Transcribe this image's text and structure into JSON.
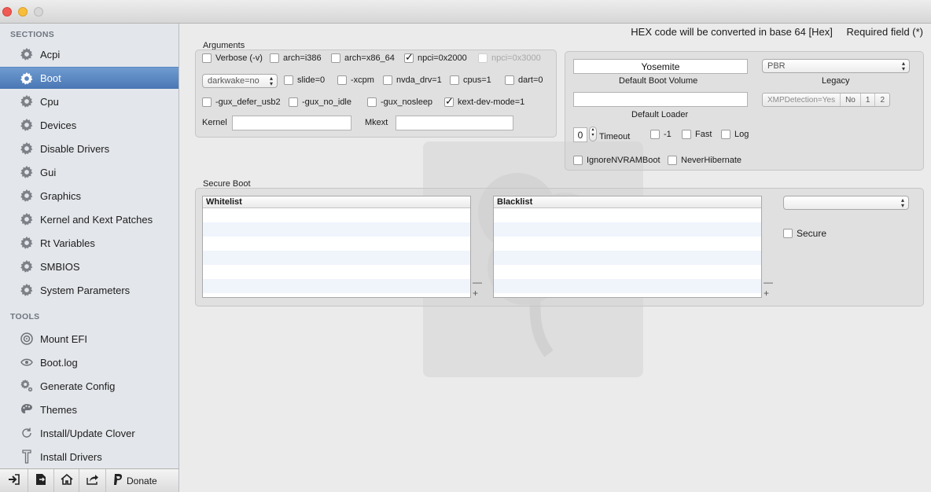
{
  "sidebar": {
    "sections_header": "SECTIONS",
    "tools_header": "TOOLS",
    "sections": [
      {
        "label": "Acpi",
        "icon": "gear-icon"
      },
      {
        "label": "Boot",
        "icon": "gear-icon",
        "selected": true
      },
      {
        "label": "Cpu",
        "icon": "gear-icon"
      },
      {
        "label": "Devices",
        "icon": "gear-icon"
      },
      {
        "label": "Disable Drivers",
        "icon": "gear-icon"
      },
      {
        "label": "Gui",
        "icon": "gear-icon"
      },
      {
        "label": "Graphics",
        "icon": "gear-icon"
      },
      {
        "label": "Kernel and Kext Patches",
        "icon": "gear-icon"
      },
      {
        "label": "Rt Variables",
        "icon": "gear-icon"
      },
      {
        "label": "SMBIOS",
        "icon": "gear-icon"
      },
      {
        "label": "System Parameters",
        "icon": "gear-icon"
      }
    ],
    "tools": [
      {
        "label": "Mount EFI",
        "icon": "disk-icon"
      },
      {
        "label": "Boot.log",
        "icon": "eye-icon"
      },
      {
        "label": "Generate Config",
        "icon": "gears-icon"
      },
      {
        "label": "Themes",
        "icon": "palette-icon"
      },
      {
        "label": "Install/Update Clover",
        "icon": "refresh-icon"
      },
      {
        "label": "Install Drivers",
        "icon": "install-icon"
      }
    ]
  },
  "bottom_toolbar": {
    "donate_label": "Donate"
  },
  "header": {
    "hex_note": "HEX code will be converted in base 64 [Hex]",
    "required_note": "Required field (*)"
  },
  "arguments": {
    "title": "Arguments",
    "verbose": "Verbose (-v)",
    "arch_i386": "arch=i386",
    "arch_x86_64": "arch=x86_64",
    "npci_2000": "npci=0x2000",
    "npci_3000": "npci=0x3000",
    "darkwake": "darkwake=no",
    "slide": "slide=0",
    "xcpm": "-xcpm",
    "nvda_drv": "nvda_drv=1",
    "cpus": "cpus=1",
    "dart": "dart=0",
    "gux_defer_usb2": "-gux_defer_usb2",
    "gux_no_idle": "-gux_no_idle",
    "gux_nosleep": "-gux_nosleep",
    "kext_dev_mode": "kext-dev-mode=1",
    "kernel_label": "Kernel",
    "kernel_value": "",
    "mkext_label": "Mkext",
    "mkext_value": ""
  },
  "boot": {
    "default_volume_value": "Yosemite",
    "default_volume_label": "Default Boot Volume",
    "legacy_value": "PBR",
    "legacy_label": "Legacy",
    "default_loader_value": "",
    "default_loader_label": "Default Loader",
    "xmp_label": "XMPDetection=Yes",
    "xmp_no": "No",
    "xmp_1": "1",
    "xmp_2": "2",
    "timeout_value": "0",
    "timeout_label": "Timeout",
    "minus1": "-1",
    "fast": "Fast",
    "log": "Log",
    "ignore_nvram": "IgnoreNVRAMBoot",
    "never_hibernate": "NeverHibernate"
  },
  "secure_boot": {
    "title": "Secure Boot",
    "whitelist_header": "Whitelist",
    "blacklist_header": "Blacklist",
    "policy_value": "",
    "secure_label": "Secure"
  },
  "colors": {
    "selection": "#4a77b5",
    "sidebar_bg": "#e3e6ea",
    "close": "#f05a55",
    "minimize": "#f8be3b"
  }
}
